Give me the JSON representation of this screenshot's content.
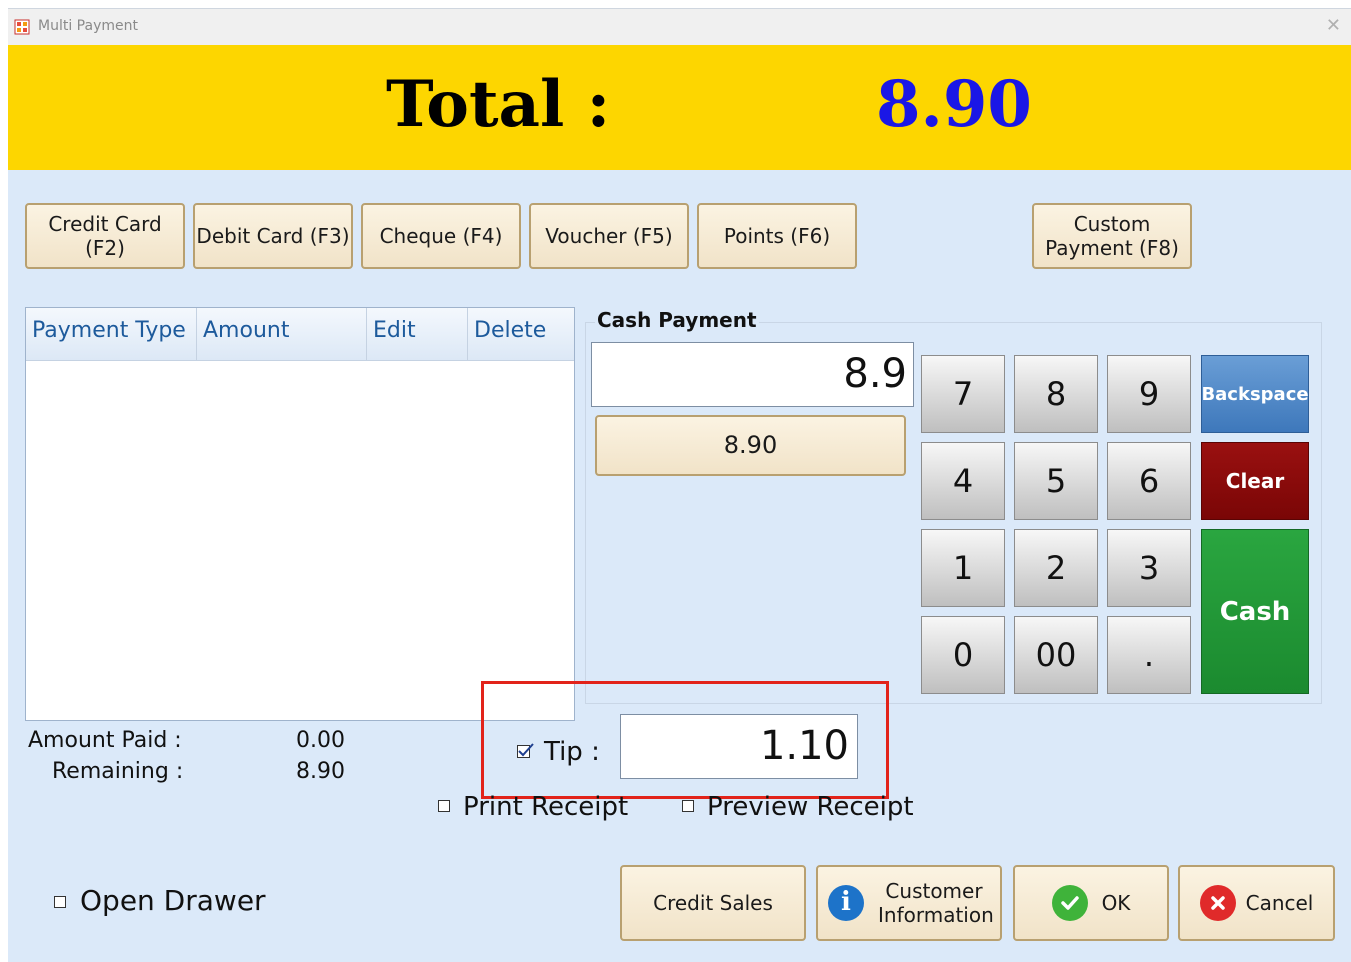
{
  "window": {
    "title": "Multi Payment",
    "close_icon": "close-icon",
    "app_icon": "pos-app-icon"
  },
  "total": {
    "label": "Total :",
    "value": "8.90",
    "value_color": "#1a17e6",
    "bar_color": "#fdd600"
  },
  "payment_buttons": [
    {
      "label": "Credit Card (F2)"
    },
    {
      "label": "Debit Card (F3)"
    },
    {
      "label": "Cheque (F4)"
    },
    {
      "label": "Voucher (F5)"
    },
    {
      "label": "Points (F6)"
    },
    {
      "label": "Custom Payment (F8)"
    }
  ],
  "grid": {
    "columns": [
      "Payment Type",
      "Amount",
      "Edit",
      "Delete"
    ],
    "rows": []
  },
  "summary": {
    "amount_paid_label": "Amount Paid :",
    "amount_paid": "0.00",
    "remaining_label": "Remaining :",
    "remaining": "8.90"
  },
  "cash_payment": {
    "title": "Cash Payment",
    "input_value": "8.9",
    "quick_amount": "8.90"
  },
  "keypad": {
    "keys": [
      "7",
      "8",
      "9",
      "4",
      "5",
      "6",
      "1",
      "2",
      "3",
      "0",
      "00",
      "."
    ],
    "backspace": "Backspace",
    "clear": "Clear",
    "cash": "Cash",
    "backspace_color": "#3e78bb",
    "clear_color": "#7a0606",
    "cash_color": "#1b8a2f"
  },
  "tip": {
    "label": "Tip :",
    "checked": true,
    "value": "1.10"
  },
  "options": {
    "print_receipt": "Print Receipt",
    "preview_receipt": "Preview Receipt",
    "open_drawer": "Open Drawer"
  },
  "actions": {
    "credit_sales": "Credit Sales",
    "customer_information": "Customer Information",
    "ok": "OK",
    "cancel": "Cancel",
    "info_icon": "info-icon",
    "ok_icon": "checkmark-icon",
    "cancel_icon": "x-circle-icon"
  }
}
